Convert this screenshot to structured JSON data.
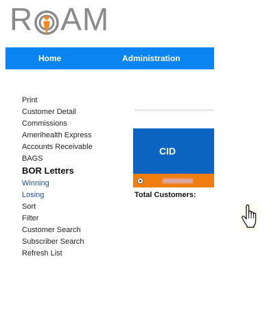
{
  "logo": {
    "letters": [
      "R",
      "A",
      "M"
    ]
  },
  "nav": {
    "home": "Home",
    "administration": "Administration"
  },
  "menu": {
    "items": [
      "Print",
      "Customer Detail",
      "Commissions",
      "Amerihealth Express",
      "Accounts Receivable",
      "BAGS",
      "BOR Letters",
      "Winning",
      "Losing",
      "Sort",
      "Filter",
      "Customer Search",
      "Subscriber Search",
      "Refresh List"
    ]
  },
  "grid": {
    "header": "CID",
    "total_label": "Total Customers:"
  },
  "colors": {
    "nav_blue": "#0a84f0",
    "header_blue": "#0b64c0",
    "row_orange": "#f07d10",
    "logo_orange": "#f08a1c",
    "logo_gray": "#8a8a8a"
  },
  "icons": {
    "cursor": "hand-pointer-icon",
    "logo_mark": "target-person-icon"
  }
}
